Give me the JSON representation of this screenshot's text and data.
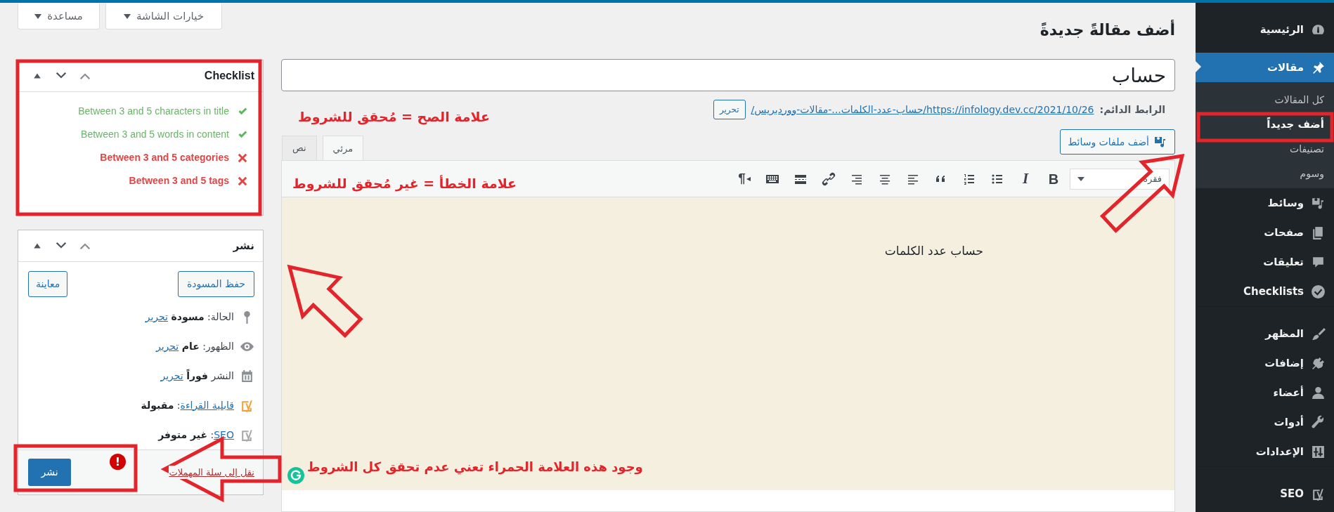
{
  "top_buttons": [
    {
      "label": "خيارات الشاشة"
    },
    {
      "label": "مساعدة"
    }
  ],
  "heading": "أضف مقالةً جديدةً",
  "title_field": {
    "value": "حساب"
  },
  "permalink": {
    "label": "الرابط الدائم:",
    "url": "https://infology.dev.cc/2021/10/26/حساب-عدد-الكلمات...-مقالات-ووردبريس/",
    "edit": "تحرير"
  },
  "add_media": "أضف ملفات وسائط",
  "editor_tabs": [
    {
      "label": "مرئي",
      "selected": true
    },
    {
      "label": "نص",
      "selected": false
    }
  ],
  "format_select": "فقرة",
  "toolbar": [
    {
      "kind": "bold",
      "glyph": "B"
    },
    {
      "kind": "italic",
      "glyph": "I"
    },
    {
      "kind": "bullets"
    },
    {
      "kind": "numbers"
    },
    {
      "kind": "quote"
    },
    {
      "kind": "align-left"
    },
    {
      "kind": "align-center"
    },
    {
      "kind": "align-right"
    },
    {
      "kind": "link"
    },
    {
      "kind": "more"
    },
    {
      "kind": "toolbar-toggle"
    },
    {
      "kind": "rtl",
      "glyph": "¶"
    }
  ],
  "content": "حساب عدد الكلمات",
  "checklist": {
    "title": "Checklist",
    "items": [
      {
        "label": "Between 3 and 5 characters in title",
        "passed": true
      },
      {
        "label": "Between 3 and 5 words in content",
        "passed": true
      },
      {
        "label": "Between 3 and 5 categories",
        "passed": false
      },
      {
        "label": "Between 3 and 5 tags",
        "passed": false
      }
    ]
  },
  "publish": {
    "title": "نشر",
    "save_draft": "حفظ المسودة",
    "preview": "معاينة",
    "rows": [
      {
        "kind": "status",
        "label": "الحالة:",
        "value": "مسودة",
        "link": "تحرير"
      },
      {
        "kind": "status",
        "label": "الظهور:",
        "value": "عام",
        "link": "تحرير"
      },
      {
        "kind": "status",
        "label": "النشر",
        "value": "فوراً",
        "link": "تحرير"
      },
      {
        "kind": "score",
        "color": "#f0a23a",
        "link": "قابلية القراءة",
        "label": ":",
        "value": "مقبولة"
      },
      {
        "kind": "score",
        "color": "#a7aaad",
        "link": "SEO",
        "label": ":",
        "value": "غير متوفر"
      }
    ],
    "trash": "نقل إلى سلة المهملات",
    "error_badge": "!",
    "publish_button": "نشر"
  },
  "sidebar": {
    "items": [
      {
        "label": "الرئيسية",
        "selected": false
      },
      {
        "label": "مقالات",
        "selected": true,
        "children": [
          {
            "label": "كل المقالات",
            "selected": false
          },
          {
            "label": "أضف جديداً",
            "selected": true
          },
          {
            "label": "تصنيفات",
            "selected": false
          },
          {
            "label": "وسوم",
            "selected": false
          }
        ]
      },
      {
        "label": "وسائط",
        "selected": false
      },
      {
        "label": "صفحات",
        "selected": false
      },
      {
        "label": "تعليقات",
        "selected": false
      },
      {
        "label": "Checklists",
        "selected": false
      },
      {
        "label": "المظهر",
        "selected": false,
        "separated": true
      },
      {
        "label": "إضافات",
        "selected": false
      },
      {
        "label": "أعضاء",
        "selected": false
      },
      {
        "label": "أدوات",
        "selected": false
      },
      {
        "label": "الإعدادات",
        "selected": false
      },
      {
        "label": "SEO",
        "selected": false,
        "separated": true
      }
    ]
  },
  "annotations": [
    {
      "text": "علامة الصح = مُحقق للشروط"
    },
    {
      "text": "علامة الخطأ = غير مُحقق للشروط"
    },
    {
      "text": "وجود هذه العلامة الحمراء تعني عدم تحقق كل الشروط"
    }
  ]
}
